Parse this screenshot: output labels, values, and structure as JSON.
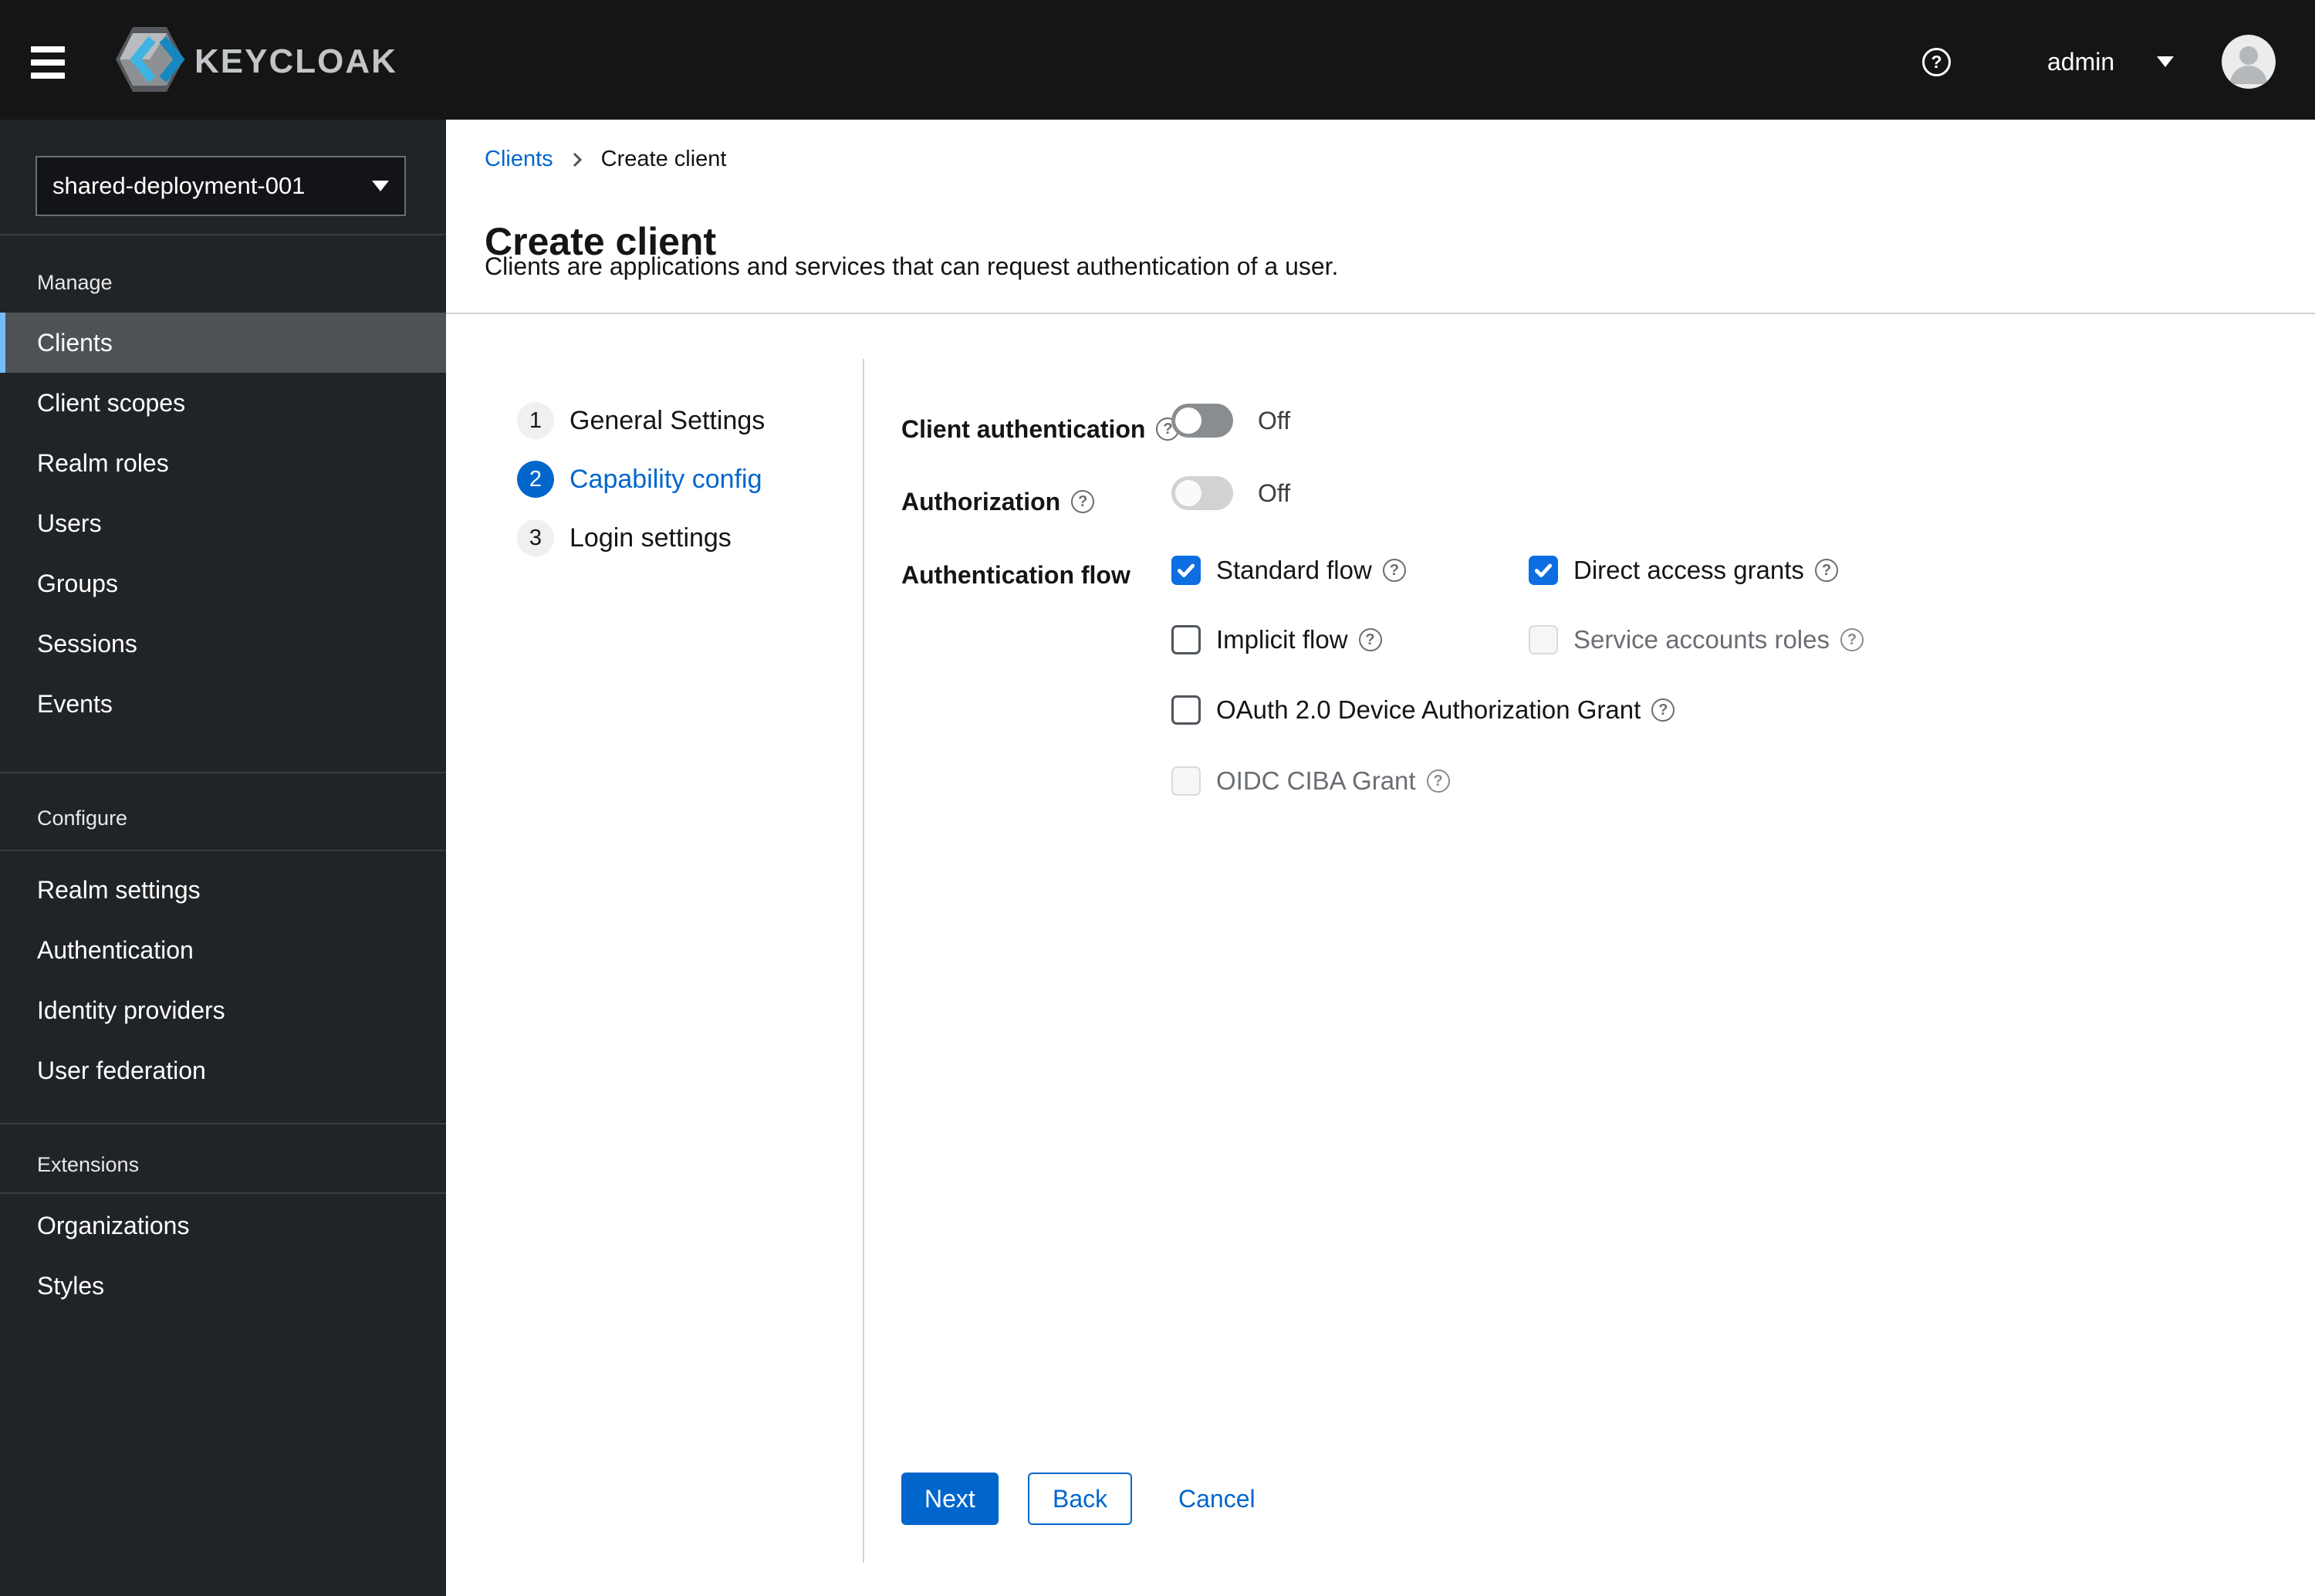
{
  "header": {
    "brand": "KEYCLOAK",
    "username": "admin"
  },
  "sidebar": {
    "realm": "shared-deployment-001",
    "sections": [
      {
        "label": "Manage",
        "items": [
          {
            "label": "Clients",
            "active": true
          },
          {
            "label": "Client scopes"
          },
          {
            "label": "Realm roles"
          },
          {
            "label": "Users"
          },
          {
            "label": "Groups"
          },
          {
            "label": "Sessions"
          },
          {
            "label": "Events"
          }
        ]
      },
      {
        "label": "Configure",
        "items": [
          {
            "label": "Realm settings"
          },
          {
            "label": "Authentication"
          },
          {
            "label": "Identity providers"
          },
          {
            "label": "User federation"
          }
        ]
      },
      {
        "label": "Extensions",
        "items": [
          {
            "label": "Organizations"
          },
          {
            "label": "Styles"
          }
        ]
      }
    ]
  },
  "breadcrumb": {
    "parent": "Clients",
    "current": "Create client"
  },
  "page": {
    "title": "Create client",
    "subtitle": "Clients are applications and services that can request authentication of a user."
  },
  "wizard": {
    "current_step": "Capability config",
    "steps": [
      {
        "number": "1",
        "label": "General Settings"
      },
      {
        "number": "2",
        "label": "Capability config"
      },
      {
        "number": "3",
        "label": "Login settings"
      }
    ]
  },
  "form": {
    "client_authentication": {
      "label": "Client authentication",
      "state": "Off"
    },
    "authorization": {
      "label": "Authorization",
      "state": "Off"
    },
    "authentication_flow": {
      "label": "Authentication flow",
      "options": [
        {
          "label": "Standard flow",
          "checked": true,
          "disabled": false
        },
        {
          "label": "Direct access grants",
          "checked": true,
          "disabled": false
        },
        {
          "label": "Implicit flow",
          "checked": false,
          "disabled": false
        },
        {
          "label": "Service accounts roles",
          "checked": false,
          "disabled": true
        },
        {
          "label": "OAuth 2.0 Device Authorization Grant",
          "checked": false,
          "disabled": false
        },
        {
          "label": "OIDC CIBA Grant",
          "checked": false,
          "disabled": true
        }
      ]
    }
  },
  "footer": {
    "next_label": "Next",
    "back_label": "Back",
    "cancel_label": "Cancel"
  },
  "colors": {
    "primary": "#0066cc",
    "link": "#0066cc",
    "checkbox_checked_bg": "#0d6ee2",
    "masthead_bg": "#151515",
    "sidebar_bg": "#212427",
    "sidebar_active_bg": "#4f5255",
    "sidebar_active_indicator": "#73bcf7",
    "divider": "#d2d2d2",
    "switch_off_bg": "#8a8d90",
    "disabled_text": "#6a6e73",
    "logo_blue_light": "#3fb3e3",
    "logo_blue_dark": "#1787bf"
  }
}
